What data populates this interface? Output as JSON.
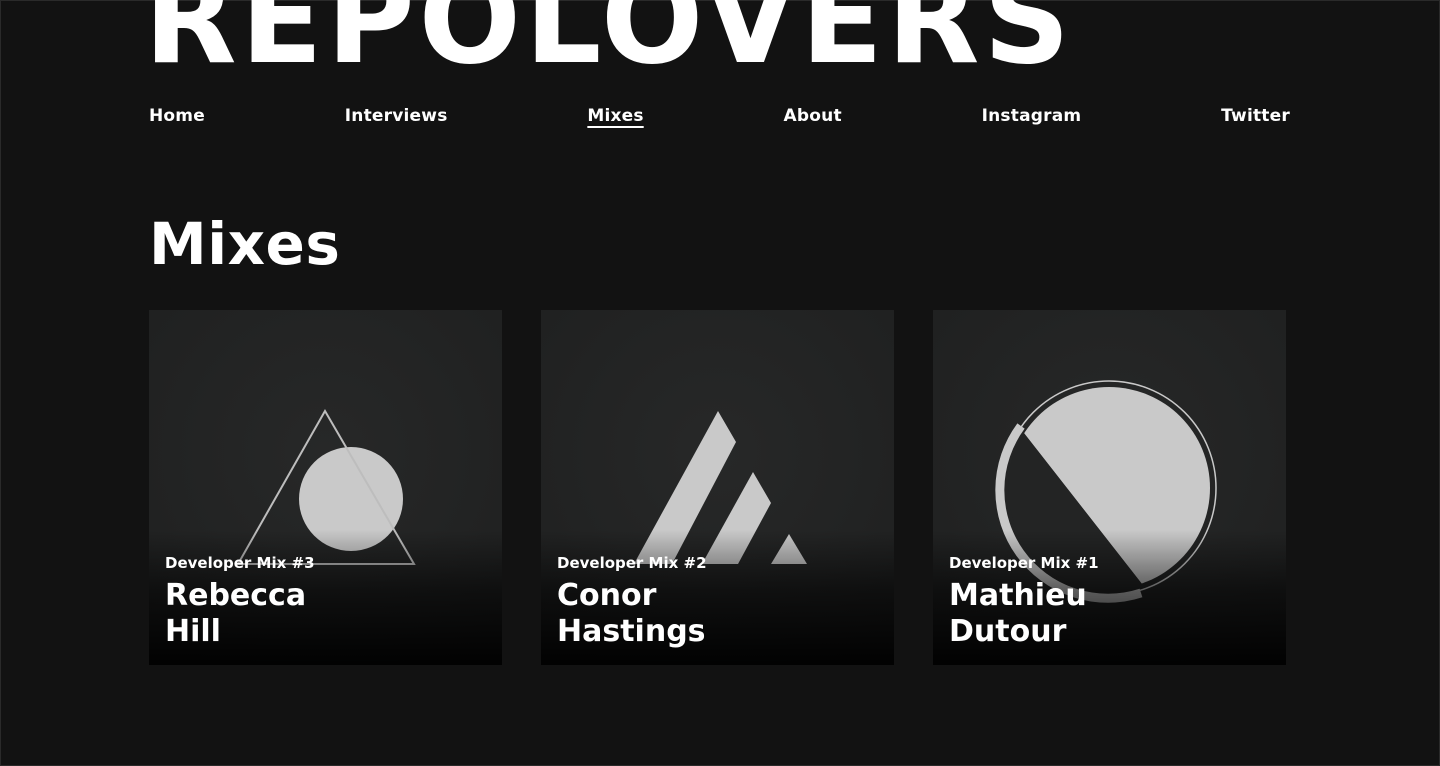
{
  "site": {
    "logo": "REPOLOVERS"
  },
  "nav": {
    "items": [
      {
        "label": "Home"
      },
      {
        "label": "Interviews"
      },
      {
        "label": "Mixes",
        "active": true
      },
      {
        "label": "About"
      },
      {
        "label": "Instagram"
      },
      {
        "label": "Twitter"
      }
    ]
  },
  "main": {
    "title": "Mixes",
    "cards": [
      {
        "subtitle": "Developer Mix #3",
        "name_line1": "Rebecca",
        "name_line2": "Hill",
        "art": "triangle-circle-icon"
      },
      {
        "subtitle": "Developer Mix #2",
        "name_line1": "Conor",
        "name_line2": "Hastings",
        "art": "stripes-triangle-icon"
      },
      {
        "subtitle": "Developer Mix #1",
        "name_line1": "Mathieu",
        "name_line2": "Dutour",
        "art": "split-circle-icon"
      }
    ]
  },
  "colors": {
    "background": "#121212",
    "card": "#222323",
    "art": "#c9c9c9",
    "text": "#ffffff"
  }
}
